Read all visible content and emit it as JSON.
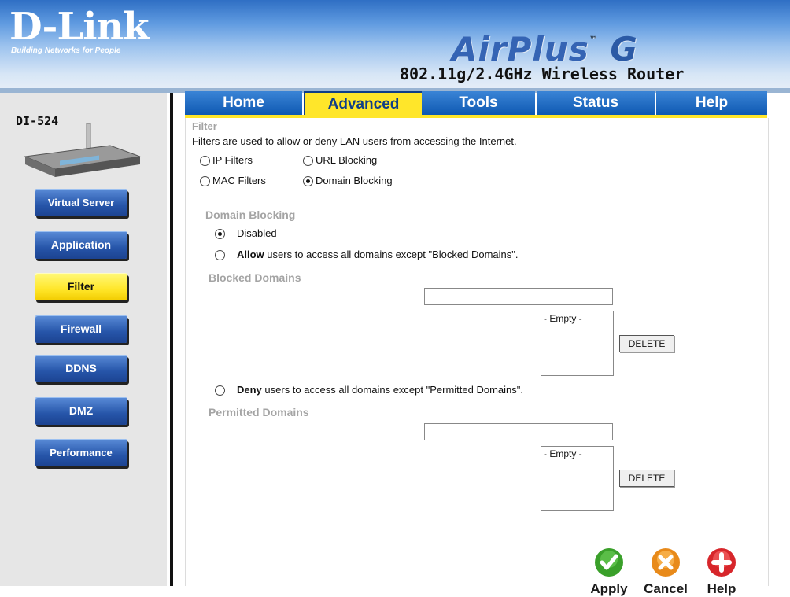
{
  "brand": {
    "logo": "D-Link",
    "tagline": "Building Networks for People",
    "product": "AirPlus",
    "product_suffix": "G",
    "trademark": "™",
    "model_line": "802.11g/2.4GHz Wireless Router"
  },
  "device": {
    "label": "DI-524"
  },
  "tabs": [
    {
      "label": "Home"
    },
    {
      "label": "Advanced"
    },
    {
      "label": "Tools"
    },
    {
      "label": "Status"
    },
    {
      "label": "Help"
    }
  ],
  "sidebar": {
    "items": [
      {
        "label": "Virtual Server"
      },
      {
        "label": "Application"
      },
      {
        "label": "Filter"
      },
      {
        "label": "Firewall"
      },
      {
        "label": "DDNS"
      },
      {
        "label": "DMZ"
      },
      {
        "label": "Performance"
      }
    ]
  },
  "filter": {
    "title": "Filter",
    "description": "Filters are used to allow or deny LAN users from accessing the Internet.",
    "options": {
      "ip": "IP Filters",
      "url": "URL Blocking",
      "mac": "MAC Filters",
      "domain": "Domain Blocking"
    },
    "selected": "Domain Blocking"
  },
  "domain_blocking": {
    "title": "Domain Blocking",
    "disabled_label": "Disabled",
    "allow_bold": "Allow",
    "allow_rest": " users to access all domains except \"Blocked Domains\".",
    "blocked_title": "Blocked Domains",
    "blocked_input": "",
    "blocked_list": "- Empty -",
    "delete": "DELETE",
    "deny_bold": "Deny",
    "deny_rest": " users to access all domains except \"Permitted Domains\".",
    "permitted_title": "Permitted Domains",
    "permitted_input": "",
    "permitted_list": "- Empty -",
    "delete2": "DELETE"
  },
  "actions": {
    "apply": "Apply",
    "cancel": "Cancel",
    "help": "Help"
  },
  "colors": {
    "tab_blue": "#0f59b2",
    "active_yellow": "#ffe62a",
    "apply_green": "#3aa02a",
    "cancel_orange": "#e88a1a",
    "help_red": "#d7262b"
  }
}
